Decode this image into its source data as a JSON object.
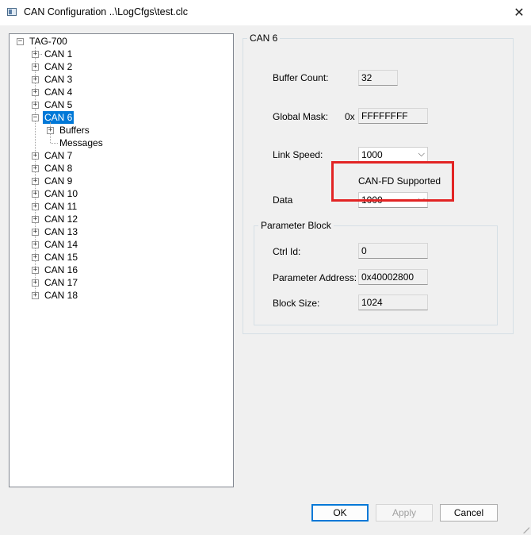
{
  "window": {
    "title": "CAN Configuration ..\\LogCfgs\\test.clc",
    "close_glyph": "✕"
  },
  "tree": {
    "root": "TAG-700",
    "items": [
      {
        "label": "CAN  1"
      },
      {
        "label": "CAN  2"
      },
      {
        "label": "CAN  3"
      },
      {
        "label": "CAN  4"
      },
      {
        "label": "CAN  5"
      },
      {
        "label": "CAN  6",
        "selected": true
      },
      {
        "label": "Buffers",
        "child": true
      },
      {
        "label": "Messages",
        "child": true,
        "leaf": true
      },
      {
        "label": "CAN  7"
      },
      {
        "label": "CAN  8"
      },
      {
        "label": "CAN  9"
      },
      {
        "label": "CAN  10"
      },
      {
        "label": "CAN  11"
      },
      {
        "label": "CAN  12"
      },
      {
        "label": "CAN  13"
      },
      {
        "label": "CAN  14"
      },
      {
        "label": "CAN  15"
      },
      {
        "label": "CAN  16"
      },
      {
        "label": "CAN  17"
      },
      {
        "label": "CAN  18"
      }
    ]
  },
  "panel": {
    "group_title": "CAN  6",
    "buffer_count": {
      "label": "Buffer Count:",
      "value": "32"
    },
    "global_mask": {
      "label": "Global Mask:",
      "prefix": "0x",
      "value": "FFFFFFFF"
    },
    "link_speed": {
      "label": "Link Speed:",
      "value": "1000"
    },
    "canfd": {
      "label": "CAN-FD Supported"
    },
    "data": {
      "label": "Data",
      "value": "1000"
    },
    "parameter_block": {
      "title": "Parameter Block",
      "ctrl_id": {
        "label": "Ctrl Id:",
        "value": "0"
      },
      "param_address": {
        "label": "Parameter Address:",
        "value": "0x40002800"
      },
      "block_size": {
        "label": "Block Size:",
        "value": "1024"
      }
    }
  },
  "buttons": {
    "ok": "OK",
    "apply": "Apply",
    "cancel": "Cancel"
  },
  "colors": {
    "highlight": "#e22424",
    "selection": "#0078d7"
  }
}
